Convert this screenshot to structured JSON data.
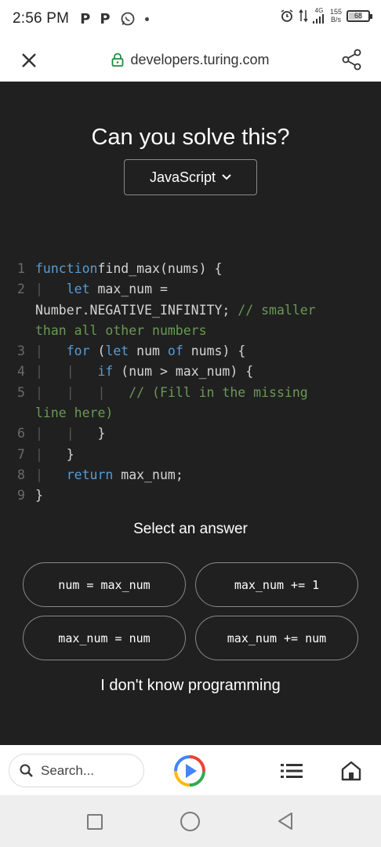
{
  "status_bar": {
    "time": "2:56 PM",
    "left_icons": [
      "p-icon",
      "p-icon",
      "whatsapp-icon",
      "notification-dot"
    ],
    "network": "4G",
    "net_speed_value": "155",
    "net_speed_unit": "B/s",
    "battery": "68"
  },
  "browser": {
    "url": "developers.turing.com"
  },
  "page": {
    "headline": "Can you solve this?",
    "language_select": "JavaScript",
    "code_lines": [
      {
        "n": "1",
        "parts": [
          [
            "kw",
            "function"
          ],
          [
            "",
            "find_max(nums) {"
          ]
        ]
      },
      {
        "n": "2",
        "parts": [
          [
            "g",
            "|   "
          ],
          [
            "kw",
            "let"
          ],
          [
            "",
            " max_num ="
          ]
        ]
      },
      {
        "n": "",
        "parts": [
          [
            "",
            "Number.NEGATIVE_INFINITY; "
          ],
          [
            "cm",
            "// smaller"
          ]
        ]
      },
      {
        "n": "",
        "parts": [
          [
            "cm",
            "than all other numbers"
          ]
        ]
      },
      {
        "n": "3",
        "parts": [
          [
            "g",
            "|   "
          ],
          [
            "kw",
            "for"
          ],
          [
            "",
            " ("
          ],
          [
            "kw",
            "let"
          ],
          [
            "",
            " num "
          ],
          [
            "kw",
            "of"
          ],
          [
            "",
            " nums) {"
          ]
        ]
      },
      {
        "n": "4",
        "parts": [
          [
            "g",
            "|   |   "
          ],
          [
            "kw",
            "if"
          ],
          [
            "",
            " (num > max_num) {"
          ]
        ]
      },
      {
        "n": "5",
        "parts": [
          [
            "g",
            "|   |   |   "
          ],
          [
            "cm",
            "// (Fill in the missing"
          ]
        ]
      },
      {
        "n": "",
        "parts": [
          [
            "cm",
            "line here)"
          ]
        ]
      },
      {
        "n": "6",
        "parts": [
          [
            "g",
            "|   |   "
          ],
          [
            "",
            "}"
          ]
        ]
      },
      {
        "n": "7",
        "parts": [
          [
            "g",
            "|   "
          ],
          [
            "",
            "}"
          ]
        ]
      },
      {
        "n": "8",
        "parts": [
          [
            "g",
            "|   "
          ],
          [
            "kw",
            "return"
          ],
          [
            "",
            " max_num;"
          ]
        ]
      },
      {
        "n": "9",
        "parts": [
          [
            "",
            "}"
          ]
        ]
      }
    ],
    "select_title": "Select an answer",
    "answers": [
      "num = max_num",
      "max_num += 1",
      "max_num = num",
      "max_num += num"
    ],
    "dont_know": "I don't know programming"
  },
  "bottom_toolbar": {
    "search_placeholder": "Search..."
  },
  "colors": {
    "page_bg": "#202020",
    "keyword": "#569cd6",
    "comment": "#6a9955",
    "lock_green": "#1e8e3e"
  }
}
